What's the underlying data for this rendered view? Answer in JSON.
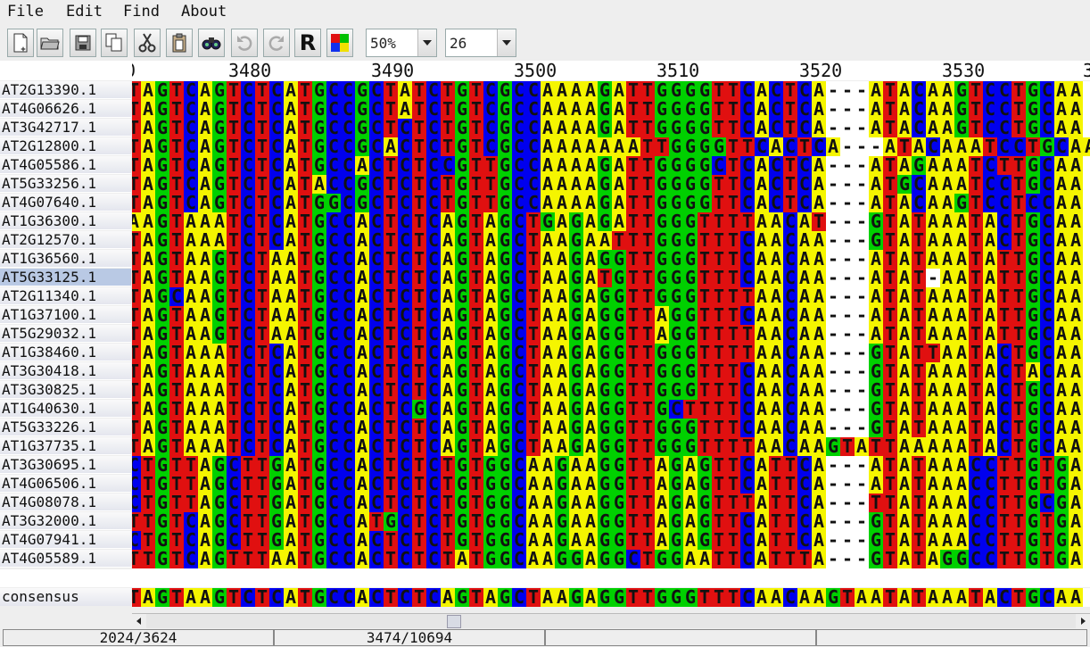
{
  "menu": [
    "File",
    "Edit",
    "Find",
    "About"
  ],
  "toolbar": {
    "icons": [
      "new-file-icon",
      "open-folder-icon",
      "save-icon",
      "copy-icon",
      "cut-icon",
      "paste-icon",
      "find-icon",
      "undo-icon",
      "redo-icon",
      "r-icon",
      "color-scheme-icon"
    ],
    "r_label": "R",
    "zoom_value": "50%",
    "font_size_value": "26"
  },
  "ruler": {
    "left_fragment": "0",
    "ticks": [
      "3480",
      "3490",
      "3500",
      "3510",
      "3520",
      "3530"
    ],
    "right_fragment": "3"
  },
  "sequences": [
    {
      "name": "AT2G13390.1",
      "seq": "TAGTCAGTCTCATGCCGCTATCTGTCGCCAAAAGATTGGGGTTCACTCA---ATACAAGTCCTGCAA"
    },
    {
      "name": "AT4G06626.1",
      "seq": "TAGTCAGTCTCATGCCGCTATCTGTCGCCAAAAGATTGGGGTTCACTCA---ATACAAGTCCTGCAA"
    },
    {
      "name": "AT3G42717.1",
      "seq": "TAGTCAGTCTCATGCCGCTCTCTGTCGCCAAAAGATTGGGGTTCACTCA---ATACAAGTCCTGCAA"
    },
    {
      "name": "AT2G12800.1",
      "seq": "TAGTCAGTCTCATGCCGCACTCTGTCGCCAAAAAAATTGGGGTTCACTCA---ATACAAATCCTGCAA"
    },
    {
      "name": "AT4G05586.1",
      "seq": "TAGTCAGTCTCATGCCACTCTCCGTTGCCAAAAGATTGGGGCTCACTCA---ATAGAAATCTTGCAA"
    },
    {
      "name": "AT5G33256.1",
      "seq": "TAGTCAGTCTCATACCGCTCTCTGTTGCCAAAAGATTGGGGTTCACTCA---ATGCAAATCCTGCAA"
    },
    {
      "name": "AT4G07640.1",
      "seq": "TAGTCAGTCTCATGGCGCTCTCTGTTGCCAAAAGATTGGGGTTCACTCA---ATACAAGTCCTCCAA"
    },
    {
      "name": "AT1G36300.1",
      "seq": "AAGTAAATCTCATGCCACTCTCAGTAGCTGAGAGATTGGGTTTTAACAT---GTATAAATACTGCAA"
    },
    {
      "name": "AT2G12570.1",
      "seq": "TAGTAAATCTCATGCCACTCTCAGTAGCTAAGAATTTGGGTTTCAACAA---GTATAAATACTGCAA"
    },
    {
      "name": "AT1G36560.1",
      "seq": "TAGTAAGTCTAATGCCACTCTCAGTAGCTAAGAGGTTGGGTTTCAACAA---ATATAAATATTGCAA"
    },
    {
      "name": "AT5G33125.1",
      "seq": "TAGTAAGTCTAATGCCACTCTCAGTAGCTAAGATGTTGGGTTTCAACAA---ATAT-AATATTGCAA"
    },
    {
      "name": "AT2G11340.1",
      "seq": "TAGCAAGTCTAATGCCACTCTCAGTAGCTAAGAGGTTGGGTTTTAACAA---ATATAAATATTGCAA"
    },
    {
      "name": "AT1G37100.1",
      "seq": "TAGTAAGTCTAATGCCACTCTCAGTAGCTAAGAGGTTAGGTTTCAACAA---ATATAAATATTGCAA"
    },
    {
      "name": "AT5G29032.1",
      "seq": "TAGTAAGTCTAATGCCACTCTCAGTAGCTAAGAGGTTAGGTTTTAACAA---ATATAAATATTGCAA"
    },
    {
      "name": "AT1G38460.1",
      "seq": "TAGTAAATCTCATGCCACTCTCAGTAGCTAAGAGGTTGGGTTTTAACAA---GTATTAATACTGCAA"
    },
    {
      "name": "AT3G30418.1",
      "seq": "TAGTAAATCTCATGCCACTCTCAGTAGCTAAGAGGTTGGGTTTCAACAA---GTATAAATACTACAA"
    },
    {
      "name": "AT3G30825.1",
      "seq": "TAGTAAATCTCATGCCACTCTCAGTAGCTAAGAGGTTGGGTTTCAACAA---GTATAAATACTGCAA"
    },
    {
      "name": "AT1G40630.1",
      "seq": "TAGTAAATCTCATGCCACTCGCAGTAGCTAAGAGGTTGCTTTTCAACAA---GTATAAATACTGCAA"
    },
    {
      "name": "AT5G33226.1",
      "seq": "TAGTAAATCTCATGCCACTCTCAGTAGCTAAGAGGTTGGGTTTCAACAA---GTATAAATACTGCAA"
    },
    {
      "name": "AT1G37735.1",
      "seq": "TAGTAAATCTCATGCCACTCTCAGTAGCTAAGAGGTTGGGTTTTAACAAGTATTAAAAATACTGCAA"
    },
    {
      "name": "AT3G30695.1",
      "seq": "CTGTTAGCTTGATGCCACTCTCTGTGGCAAGAAGGTTAGAGTTCATTCA---ATATAAACCTTGTGA"
    },
    {
      "name": "AT4G06506.1",
      "seq": "CTGTTAGCTTGATGCCACTCTCTGTGGCAAGAAGGTTAGAGTTCATTCA---ATATAAACCTTGTGA"
    },
    {
      "name": "AT4G08078.1",
      "seq": "CTGTTAGCTTGATGCCACTCTCTGTGGCAAGAAGGTTAGAGTTTATTCA---TTATAAACCTTGCGA"
    },
    {
      "name": "AT3G32000.1",
      "seq": "TTGTCAGCTTGATGCCATGCTCTGTGGCAAGAAGGTTAGAGTTCATTCA---GTATAAACCTTGTGA"
    },
    {
      "name": "AT4G07941.1",
      "seq": "CTGTCAGCTTGATGCCACTCTCTGTGGCAAGAAGGTTAGAGTTCATTCA---GTATAAACCTTGTGA"
    },
    {
      "name": "AT4G05589.1",
      "seq": "TTGTCAGTTTAATGCCACTCTCTATGGCAAGGAGGCTGGAATTCATTTA---GTATAGGCCTTGTGA"
    }
  ],
  "selected_index": 10,
  "consensus": {
    "label": "consensus",
    "seq": "TAGTAAGTCTCATGCCACTCTCAGTAGCTAAGAGGTTGGGTTTCAACAAGTAATATAAATACTGCAA"
  },
  "colors": {
    "A": "#f5f500",
    "T": "#e01010",
    "G": "#00d000",
    "C": "#0000ee",
    "-": "#ffffff"
  },
  "status": [
    "2024/3624",
    "3474/10694",
    "",
    ""
  ]
}
